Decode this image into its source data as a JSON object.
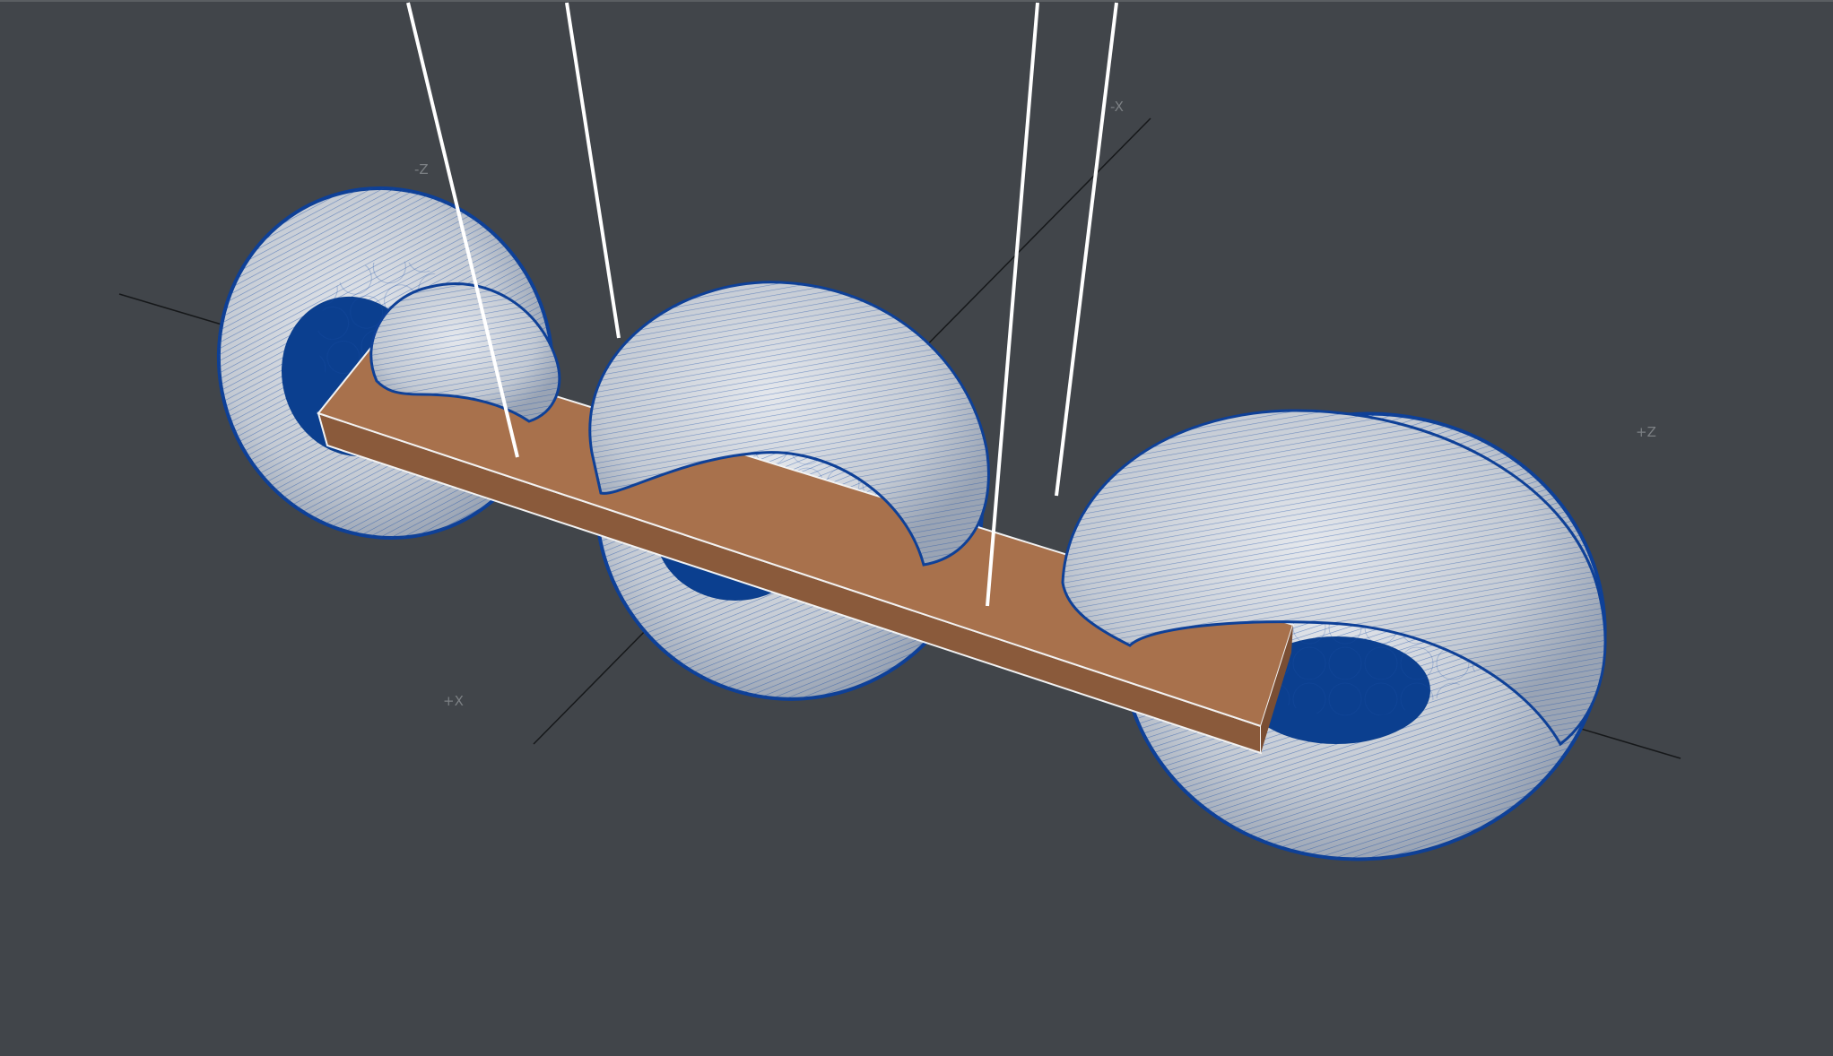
{
  "scene": {
    "background_color": "#41454a",
    "torus_wire_color": "#1a4fa8",
    "torus_fill_color": "#c9ced6",
    "torus_hole_color": "#0b3f8f",
    "bar_top_color": "#a8714c",
    "bar_side_color": "#8a5a3b",
    "bar_edge_color": "#f2f2f2",
    "cable_color": "#ffffff",
    "grid_axis_color": "#16181a"
  },
  "axis_labels": {
    "neg_z_left": "-Z",
    "neg_x_top": "-X",
    "pos_z_right": "+Z",
    "pos_x_bottom": "+X"
  }
}
